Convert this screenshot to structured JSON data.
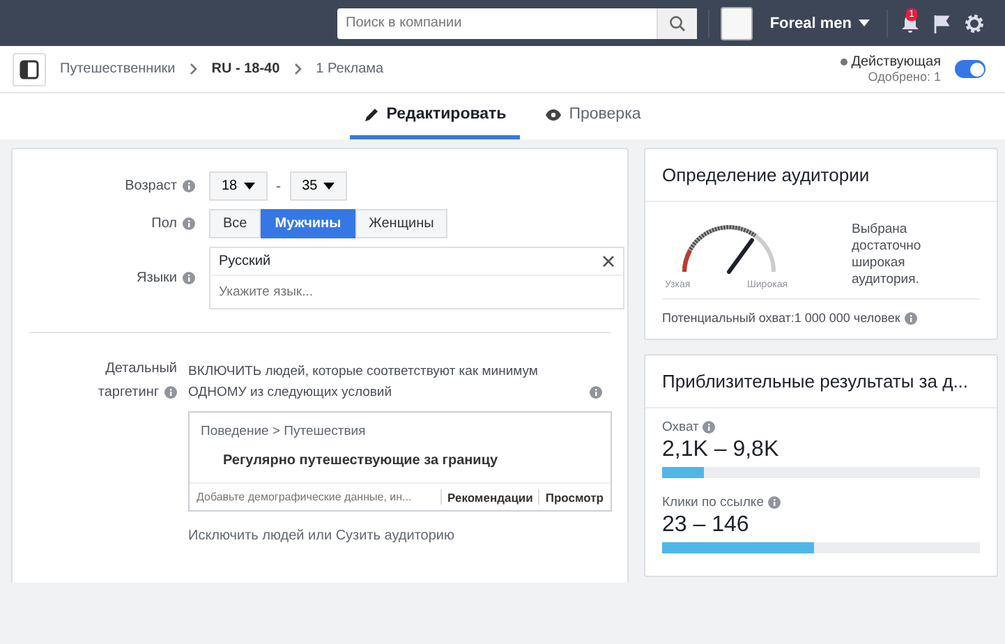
{
  "topbar": {
    "search": {
      "placeholder": "Поиск в компании"
    },
    "account": "Foreal men",
    "notifications": "1"
  },
  "breadcrumbs": [
    {
      "label": "Путешественники",
      "bold": false
    },
    {
      "label": "RU - 18-40",
      "bold": true
    },
    {
      "label": "1 Реклама",
      "bold": false
    }
  ],
  "status": {
    "label": "Действующая",
    "sub": "Одобрено: 1",
    "on": true
  },
  "tabs": [
    {
      "label": "Редактировать",
      "selected": true
    },
    {
      "label": "Проверка",
      "selected": false
    }
  ],
  "form": {
    "age": {
      "label": "Возраст",
      "from": "18",
      "separator": "-",
      "to": "35"
    },
    "gender": {
      "label": "Пол",
      "options": [
        {
          "label": "Все",
          "selected": false
        },
        {
          "label": "Мужчины",
          "selected": true
        },
        {
          "label": "Женщины",
          "selected": false
        }
      ]
    },
    "languages": {
      "label": "Языки",
      "value": "Русский",
      "placeholder": "Укажите язык..."
    },
    "targeting": {
      "label_1": "Детальный",
      "label_2": "таргетинг",
      "intro": "ВКЛЮЧИТЬ людей, которые соответствуют как минимум ОДНОМУ из следующих условий",
      "category": "Поведение > Путешествия",
      "item": "Регулярно путешествующие за границу",
      "placeholder": "Добавьте демографические данные, ин...",
      "links": [
        "Рекомендации",
        "Просмотр"
      ],
      "exclude": "Исключить людей или Сузить аудиторию"
    }
  },
  "audience": {
    "title": "Определение аудитории",
    "gauge": {
      "low": "Узкая",
      "high": "Широкая"
    },
    "description": "Выбрана достаточно широкая аудитория.",
    "reach": "Потенциальный охват:1 000 000 человек"
  },
  "results": {
    "title": "Приблизительные результаты за д...",
    "metrics": [
      {
        "label": "Охват",
        "value": "2,1K – 9,8K",
        "level": 0.13
      },
      {
        "label": "Клики по ссылке",
        "value": "23 – 146",
        "level": 0.48
      }
    ]
  }
}
